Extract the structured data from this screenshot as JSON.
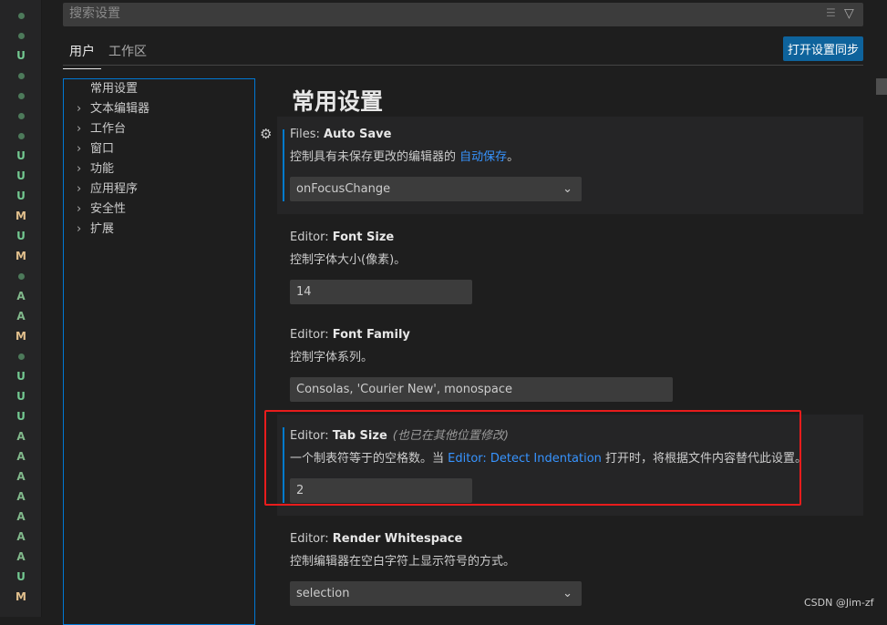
{
  "gutter": [
    "dot",
    "dot",
    "U",
    "dot",
    "dot",
    "dot",
    "dot",
    "U",
    "U",
    "U",
    "M",
    "U",
    "M",
    "dot",
    "A",
    "A",
    "M",
    "dot",
    "U",
    "U",
    "U",
    "A",
    "A",
    "A",
    "A",
    "A",
    "A",
    "A",
    "U",
    "M"
  ],
  "colors": {
    "U": "#73c991",
    "M": "#e2c08d",
    "A": "#81b88b",
    "accent": "#0e639c",
    "link": "#3794ff",
    "highlight": "#e81c1c"
  },
  "search": {
    "placeholder": "搜索设置",
    "clear_icon": "clear-filter-icon",
    "filter_icon": "filter-icon"
  },
  "tabs": [
    {
      "label": "用户",
      "active": true
    },
    {
      "label": "工作区",
      "active": false
    }
  ],
  "sync_button": "打开设置同步",
  "toc": [
    {
      "label": "常用设置",
      "chevron": false
    },
    {
      "label": "文本编辑器",
      "chevron": true
    },
    {
      "label": "工作台",
      "chevron": true
    },
    {
      "label": "窗口",
      "chevron": true
    },
    {
      "label": "功能",
      "chevron": true
    },
    {
      "label": "应用程序",
      "chevron": true
    },
    {
      "label": "安全性",
      "chevron": true
    },
    {
      "label": "扩展",
      "chevron": true
    }
  ],
  "main": {
    "title": "常用设置",
    "settings": [
      {
        "prefix": "Files: ",
        "name": "Auto Save",
        "desc": "控制具有未保存更改的编辑器的 ",
        "link": "自动保存",
        "desc_after": "。",
        "value": "onFocusChange",
        "type": "select"
      },
      {
        "prefix": "Editor: ",
        "name": "Font Size",
        "desc": "控制字体大小(像素)。",
        "value": "14",
        "type": "text"
      },
      {
        "prefix": "Editor: ",
        "name": "Font Family",
        "desc": "控制字体系列。",
        "value": "Consolas, 'Courier New', monospace",
        "type": "text"
      },
      {
        "prefix": "Editor: ",
        "name": "Tab Size",
        "note": "(也已在其他位置修改)",
        "desc": "一个制表符等于的空格数。当 ",
        "link": "Editor: Detect Indentation",
        "desc_after": " 打开时，将根据文件内容替代此设置。",
        "value": "2",
        "type": "text"
      },
      {
        "prefix": "Editor: ",
        "name": "Render Whitespace",
        "desc": "控制编辑器在空白字符上显示符号的方式。",
        "value": "selection",
        "type": "select"
      }
    ]
  },
  "watermark": "CSDN @Jim-zf"
}
